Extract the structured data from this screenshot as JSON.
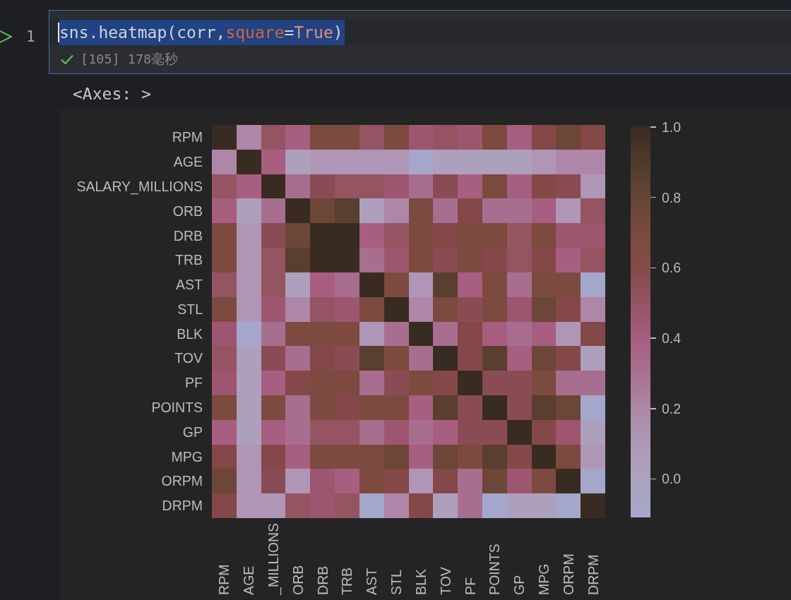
{
  "cell": {
    "line_number": "1",
    "focused": true,
    "code": {
      "selected": true,
      "tokens": [
        {
          "text": "sns.heatmap(corr,",
          "kind": "plain"
        },
        {
          "text": "square",
          "kind": "param"
        },
        {
          "text": "=",
          "kind": "plain"
        },
        {
          "text": "True",
          "kind": "keyword"
        },
        {
          "text": ")",
          "kind": "plain"
        }
      ]
    },
    "execution": {
      "success": true,
      "label": "[105] 178毫秒"
    }
  },
  "output": {
    "text": "<Axes: >",
    "heatmap": {
      "rows": [
        {
          "label": "RPM",
          "cells": [
            {
              "color": "#382b21"
            },
            {
              "color": "#ae86a8"
            },
            {
              "color": "#945462"
            },
            {
              "color": "#a85e80"
            },
            {
              "color": "#7c4a3e"
            },
            {
              "color": "#7c4a3e"
            },
            {
              "color": "#945462"
            },
            {
              "color": "#7c4a3e"
            },
            {
              "color": "#9e5670"
            },
            {
              "color": "#945462"
            },
            {
              "color": "#9e5670"
            },
            {
              "color": "#7c4a3e"
            },
            {
              "color": "#a85e80"
            },
            {
              "color": "#844848"
            },
            {
              "color": "#6c4636"
            },
            {
              "color": "#844848"
            }
          ]
        },
        {
          "label": "AGE",
          "cells": [
            {
              "color": "#ae86a8"
            },
            {
              "color": "#382b21"
            },
            {
              "color": "#a85e80"
            },
            {
              "color": "#ada0bc"
            },
            {
              "color": "#b096b6"
            },
            {
              "color": "#b096b6"
            },
            {
              "color": "#b096b6"
            },
            {
              "color": "#b096b6"
            },
            {
              "color": "#a4a7cb"
            },
            {
              "color": "#ada0bc"
            },
            {
              "color": "#ada0bc"
            },
            {
              "color": "#ada0bc"
            },
            {
              "color": "#ada0bc"
            },
            {
              "color": "#b096b6"
            },
            {
              "color": "#ae86a8"
            },
            {
              "color": "#ae86a8"
            }
          ]
        },
        {
          "label": "SALARY_MILLIONS",
          "cells": [
            {
              "color": "#945462"
            },
            {
              "color": "#a85e80"
            },
            {
              "color": "#382b21"
            },
            {
              "color": "#a86e90"
            },
            {
              "color": "#8a4c54"
            },
            {
              "color": "#945462"
            },
            {
              "color": "#945462"
            },
            {
              "color": "#9e5670"
            },
            {
              "color": "#a86e90"
            },
            {
              "color": "#8a4c54"
            },
            {
              "color": "#a85e80"
            },
            {
              "color": "#7c4a3e"
            },
            {
              "color": "#a85e80"
            },
            {
              "color": "#844848"
            },
            {
              "color": "#8a4c54"
            },
            {
              "color": "#b096b6"
            }
          ]
        },
        {
          "label": "ORB",
          "cells": [
            {
              "color": "#a85e80"
            },
            {
              "color": "#ada0bc"
            },
            {
              "color": "#a86e90"
            },
            {
              "color": "#382b21"
            },
            {
              "color": "#6c4636"
            },
            {
              "color": "#5a3e2f"
            },
            {
              "color": "#ada0bc"
            },
            {
              "color": "#ae86a8"
            },
            {
              "color": "#7c4a3e"
            },
            {
              "color": "#a86e90"
            },
            {
              "color": "#844848"
            },
            {
              "color": "#a86e90"
            },
            {
              "color": "#a86e90"
            },
            {
              "color": "#a85e80"
            },
            {
              "color": "#b096b6"
            },
            {
              "color": "#945462"
            }
          ]
        },
        {
          "label": "DRB",
          "cells": [
            {
              "color": "#7c4a3e"
            },
            {
              "color": "#b096b6"
            },
            {
              "color": "#8a4c54"
            },
            {
              "color": "#6c4636"
            },
            {
              "color": "#382b21"
            },
            {
              "color": "#382b21"
            },
            {
              "color": "#a85e80"
            },
            {
              "color": "#945462"
            },
            {
              "color": "#7c4a3e"
            },
            {
              "color": "#844848"
            },
            {
              "color": "#7c4a3e"
            },
            {
              "color": "#7c4a3e"
            },
            {
              "color": "#945462"
            },
            {
              "color": "#7c4a3e"
            },
            {
              "color": "#9e5670"
            },
            {
              "color": "#9e5670"
            }
          ]
        },
        {
          "label": "TRB",
          "cells": [
            {
              "color": "#7c4a3e"
            },
            {
              "color": "#b096b6"
            },
            {
              "color": "#945462"
            },
            {
              "color": "#5a3e2f"
            },
            {
              "color": "#382b21"
            },
            {
              "color": "#382b21"
            },
            {
              "color": "#a86e90"
            },
            {
              "color": "#9e5670"
            },
            {
              "color": "#7c4a3e"
            },
            {
              "color": "#8a4c54"
            },
            {
              "color": "#7c4a3e"
            },
            {
              "color": "#844848"
            },
            {
              "color": "#945462"
            },
            {
              "color": "#844848"
            },
            {
              "color": "#a85e80"
            },
            {
              "color": "#945462"
            }
          ]
        },
        {
          "label": "AST",
          "cells": [
            {
              "color": "#945462"
            },
            {
              "color": "#b096b6"
            },
            {
              "color": "#945462"
            },
            {
              "color": "#ada0bc"
            },
            {
              "color": "#a85e80"
            },
            {
              "color": "#a86e90"
            },
            {
              "color": "#382b21"
            },
            {
              "color": "#7c4a3e"
            },
            {
              "color": "#b096b6"
            },
            {
              "color": "#5a3e2f"
            },
            {
              "color": "#a85e80"
            },
            {
              "color": "#7c4a3e"
            },
            {
              "color": "#a86e90"
            },
            {
              "color": "#7c4a3e"
            },
            {
              "color": "#7c4a3e"
            },
            {
              "color": "#a4a7cb"
            }
          ]
        },
        {
          "label": "STL",
          "cells": [
            {
              "color": "#7c4a3e"
            },
            {
              "color": "#b096b6"
            },
            {
              "color": "#9e5670"
            },
            {
              "color": "#ae86a8"
            },
            {
              "color": "#945462"
            },
            {
              "color": "#9e5670"
            },
            {
              "color": "#7c4a3e"
            },
            {
              "color": "#382b21"
            },
            {
              "color": "#ae86a8"
            },
            {
              "color": "#7c4a3e"
            },
            {
              "color": "#8a4c54"
            },
            {
              "color": "#7c4a3e"
            },
            {
              "color": "#9e5670"
            },
            {
              "color": "#6c4636"
            },
            {
              "color": "#844848"
            },
            {
              "color": "#ae86a8"
            }
          ]
        },
        {
          "label": "BLK",
          "cells": [
            {
              "color": "#9e5670"
            },
            {
              "color": "#a4a7cb"
            },
            {
              "color": "#a86e90"
            },
            {
              "color": "#7c4a3e"
            },
            {
              "color": "#7c4a3e"
            },
            {
              "color": "#7c4a3e"
            },
            {
              "color": "#b096b6"
            },
            {
              "color": "#a86e90"
            },
            {
              "color": "#382b21"
            },
            {
              "color": "#a86e90"
            },
            {
              "color": "#844848"
            },
            {
              "color": "#a85e80"
            },
            {
              "color": "#a86e90"
            },
            {
              "color": "#a85e80"
            },
            {
              "color": "#b096b6"
            },
            {
              "color": "#844848"
            }
          ]
        },
        {
          "label": "TOV",
          "cells": [
            {
              "color": "#945462"
            },
            {
              "color": "#ada0bc"
            },
            {
              "color": "#8a4c54"
            },
            {
              "color": "#a86e90"
            },
            {
              "color": "#844848"
            },
            {
              "color": "#8a4c54"
            },
            {
              "color": "#5a3e2f"
            },
            {
              "color": "#7c4a3e"
            },
            {
              "color": "#a86e90"
            },
            {
              "color": "#382b21"
            },
            {
              "color": "#844848"
            },
            {
              "color": "#5a3e2f"
            },
            {
              "color": "#a85e80"
            },
            {
              "color": "#6c4636"
            },
            {
              "color": "#844848"
            },
            {
              "color": "#ada0bc"
            }
          ]
        },
        {
          "label": "PF",
          "cells": [
            {
              "color": "#9e5670"
            },
            {
              "color": "#ada0bc"
            },
            {
              "color": "#a85e80"
            },
            {
              "color": "#844848"
            },
            {
              "color": "#7c4a3e"
            },
            {
              "color": "#7c4a3e"
            },
            {
              "color": "#a86e90"
            },
            {
              "color": "#8a4c54"
            },
            {
              "color": "#7c4a3e"
            },
            {
              "color": "#844848"
            },
            {
              "color": "#382b21"
            },
            {
              "color": "#8a4c54"
            },
            {
              "color": "#8a4c54"
            },
            {
              "color": "#7c4a3e"
            },
            {
              "color": "#a86e90"
            },
            {
              "color": "#a86e90"
            }
          ]
        },
        {
          "label": "POINTS",
          "cells": [
            {
              "color": "#7c4a3e"
            },
            {
              "color": "#ada0bc"
            },
            {
              "color": "#7c4a3e"
            },
            {
              "color": "#a86e90"
            },
            {
              "color": "#7c4a3e"
            },
            {
              "color": "#844848"
            },
            {
              "color": "#7c4a3e"
            },
            {
              "color": "#7c4a3e"
            },
            {
              "color": "#a85e80"
            },
            {
              "color": "#5a3e2f"
            },
            {
              "color": "#8a4c54"
            },
            {
              "color": "#382b21"
            },
            {
              "color": "#8a4c54"
            },
            {
              "color": "#5a3e2f"
            },
            {
              "color": "#6c4636"
            },
            {
              "color": "#a4a7cb"
            }
          ]
        },
        {
          "label": "GP",
          "cells": [
            {
              "color": "#a85e80"
            },
            {
              "color": "#ada0bc"
            },
            {
              "color": "#a85e80"
            },
            {
              "color": "#a86e90"
            },
            {
              "color": "#945462"
            },
            {
              "color": "#945462"
            },
            {
              "color": "#a86e90"
            },
            {
              "color": "#9e5670"
            },
            {
              "color": "#a86e90"
            },
            {
              "color": "#a85e80"
            },
            {
              "color": "#8a4c54"
            },
            {
              "color": "#8a4c54"
            },
            {
              "color": "#382b21"
            },
            {
              "color": "#844848"
            },
            {
              "color": "#9e5670"
            },
            {
              "color": "#ada0bc"
            }
          ]
        },
        {
          "label": "MPG",
          "cells": [
            {
              "color": "#844848"
            },
            {
              "color": "#b096b6"
            },
            {
              "color": "#844848"
            },
            {
              "color": "#a85e80"
            },
            {
              "color": "#7c4a3e"
            },
            {
              "color": "#7c4a3e"
            },
            {
              "color": "#7c4a3e"
            },
            {
              "color": "#6c4636"
            },
            {
              "color": "#a85e80"
            },
            {
              "color": "#6c4636"
            },
            {
              "color": "#7c4a3e"
            },
            {
              "color": "#5a3e2f"
            },
            {
              "color": "#844848"
            },
            {
              "color": "#382b21"
            },
            {
              "color": "#7c4a3e"
            },
            {
              "color": "#b096b6"
            }
          ]
        },
        {
          "label": "ORPM",
          "cells": [
            {
              "color": "#6c4636"
            },
            {
              "color": "#b096b6"
            },
            {
              "color": "#8a4c54"
            },
            {
              "color": "#b096b6"
            },
            {
              "color": "#9e5670"
            },
            {
              "color": "#a85e80"
            },
            {
              "color": "#7c4a3e"
            },
            {
              "color": "#844848"
            },
            {
              "color": "#b096b6"
            },
            {
              "color": "#844848"
            },
            {
              "color": "#a86e90"
            },
            {
              "color": "#6c4636"
            },
            {
              "color": "#9e5670"
            },
            {
              "color": "#7c4a3e"
            },
            {
              "color": "#382b21"
            },
            {
              "color": "#a4a7cb"
            }
          ]
        },
        {
          "label": "DRPM",
          "cells": [
            {
              "color": "#844848"
            },
            {
              "color": "#b096b6"
            },
            {
              "color": "#b096b6"
            },
            {
              "color": "#945462"
            },
            {
              "color": "#9e5670"
            },
            {
              "color": "#945462"
            },
            {
              "color": "#a4a7cb"
            },
            {
              "color": "#ae86a8"
            },
            {
              "color": "#844848"
            },
            {
              "color": "#ada0bc"
            },
            {
              "color": "#a86e90"
            },
            {
              "color": "#a4a7cb"
            },
            {
              "color": "#ada0bc"
            },
            {
              "color": "#ada0bc"
            },
            {
              "color": "#a4a7cb"
            },
            {
              "color": "#382b21"
            }
          ]
        }
      ],
      "columns": [
        "RPM",
        "AGE",
        "_MILLIONS",
        "ORB",
        "DRB",
        "TRB",
        "AST",
        "STL",
        "BLK",
        "TOV",
        "PF",
        "POINTS",
        "GP",
        "MPG",
        "ORPM",
        "DRPM"
      ],
      "colorbar_ticks": [
        "1.0",
        "0.8",
        "0.6",
        "0.4",
        "0.2",
        "0.0"
      ]
    }
  }
}
